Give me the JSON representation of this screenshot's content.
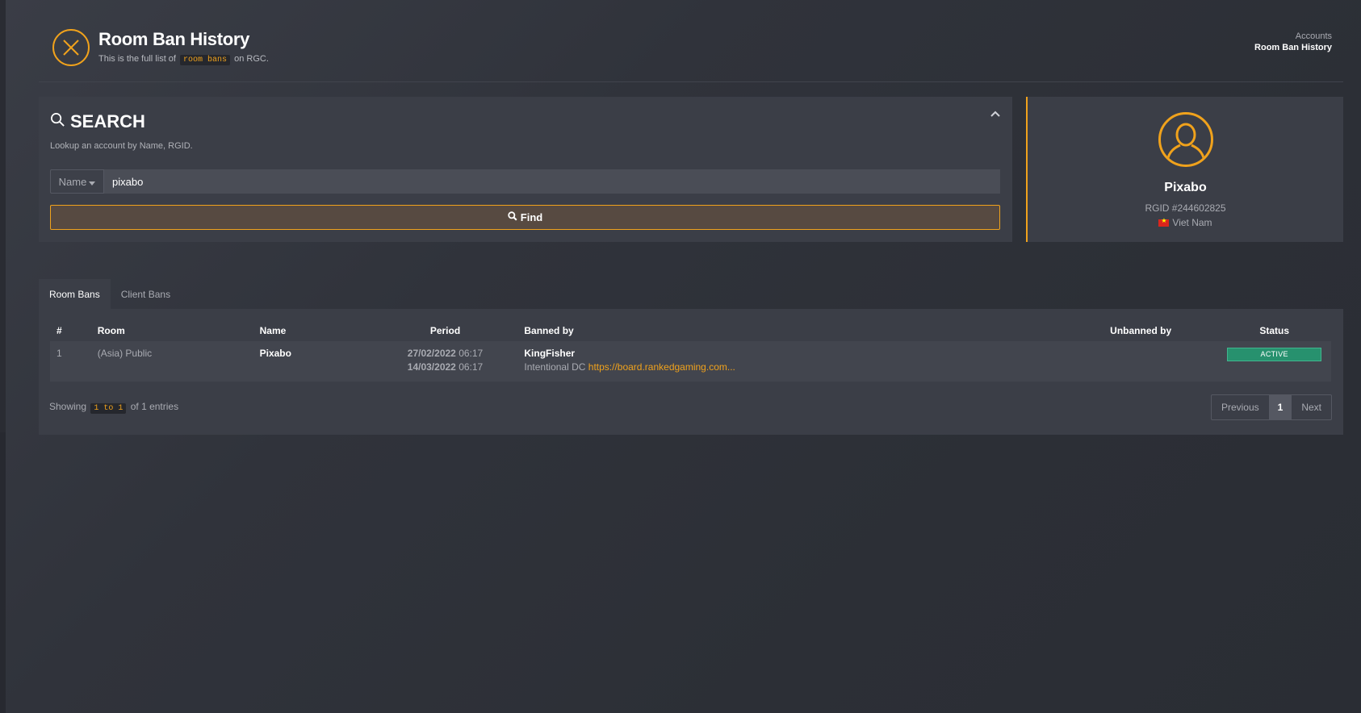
{
  "header": {
    "title": "Room Ban History",
    "subtitle_prefix": "This is the full list of",
    "subtitle_code": "room bans",
    "subtitle_suffix": "on RGC.",
    "breadcrumb_parent": "Accounts",
    "breadcrumb_current": "Room Ban History"
  },
  "search": {
    "title": "SEARCH",
    "description": "Lookup an account by Name, RGID.",
    "filter_label": "Name",
    "input_value": "pixabo",
    "find_label": "Find"
  },
  "profile": {
    "name": "Pixabo",
    "rgid": "RGID #244602825",
    "country": "Viet Nam"
  },
  "tabs": [
    {
      "label": "Room Bans",
      "active": true
    },
    {
      "label": "Client Bans",
      "active": false
    }
  ],
  "table": {
    "headers": {
      "num": "#",
      "room": "Room",
      "name": "Name",
      "period": "Period",
      "banned_by": "Banned by",
      "unbanned_by": "Unbanned by",
      "status": "Status"
    },
    "rows": [
      {
        "num": "1",
        "room": "(Asia) Public",
        "name": "Pixabo",
        "start_date": "27/02/2022",
        "start_time": "06:17",
        "end_date": "14/03/2022",
        "end_time": "06:17",
        "banned_by": "KingFisher",
        "reason": "Intentional DC",
        "link": "https://board.rankedgaming.com...",
        "unbanned_by": "",
        "status": "ACTIVE"
      }
    ]
  },
  "pagination": {
    "showing_prefix": "Showing",
    "showing_range": "1 to 1",
    "showing_suffix": "of 1 entries",
    "previous": "Previous",
    "current_page": "1",
    "next": "Next"
  },
  "colors": {
    "accent": "#f0a21c",
    "status_active": "#27916e",
    "card_bg": "#3b3e47"
  }
}
